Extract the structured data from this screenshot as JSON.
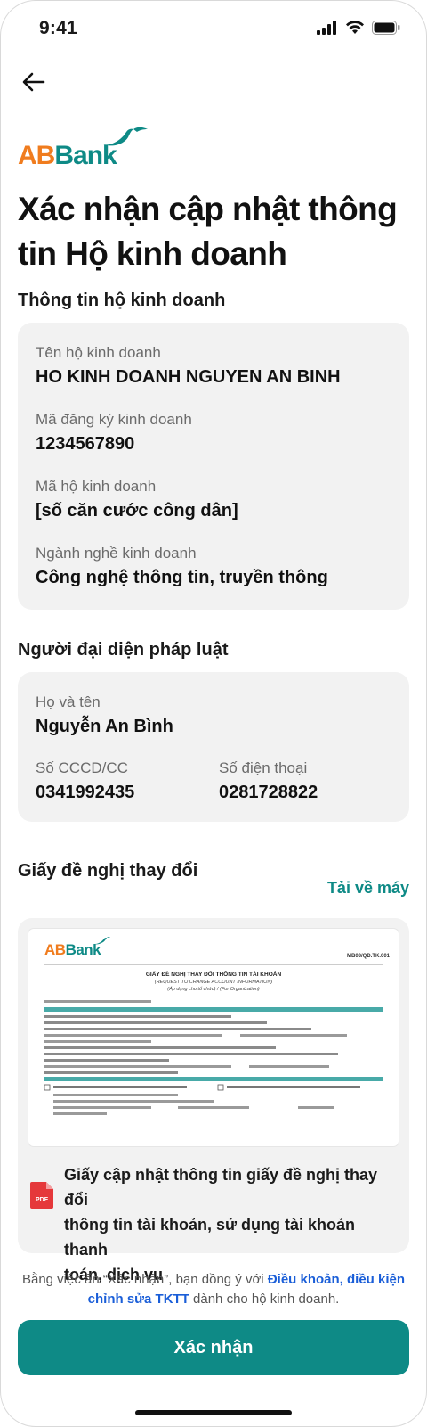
{
  "status_bar": {
    "time": "9:41"
  },
  "header": {
    "back_icon": "arrow-left-icon"
  },
  "logo": {
    "text_ab": "AB",
    "text_bank": "Bank",
    "brand_orange": "#f07c1e",
    "brand_teal": "#0e8a86"
  },
  "title": {
    "line1": "Xác nhận cập nhật thông",
    "line2": "tin Hộ kinh doanh"
  },
  "business": {
    "section_title": "Thông tin hộ kinh doanh",
    "fields": [
      {
        "label": "Tên hộ kinh doanh",
        "value": "HO KINH DOANH NGUYEN AN BINH"
      },
      {
        "label": "Mã đăng ký kinh doanh",
        "value": "1234567890"
      },
      {
        "label": "Mã hộ kinh doanh",
        "value": "[số căn cước công dân]"
      },
      {
        "label": "Ngành nghề kinh doanh",
        "value": "Công nghệ thông tin, truyền thông"
      }
    ]
  },
  "representative": {
    "section_title": "Người đại diện pháp luật",
    "name_label": "Họ và tên",
    "name_value": "Nguyễn An Bình",
    "id_label": "Số CCCD/CC",
    "id_value": "0341992435",
    "phone_label": "Số điện thoại",
    "phone_value": "0281728822"
  },
  "document": {
    "section_title": "Giấy đề nghị thay đổi",
    "download_label": "Tải về máy",
    "name_line1": "Giấy cập nhật thông tin giấy đề nghị thay đổi",
    "name_line2": "thông tin tài khoản, sử dụng tài khoản thanh",
    "name_line3": "toán, dịch vụ",
    "file_icon": "pdf-icon",
    "preview": {
      "logo_ab": "AB",
      "logo_bank": "Bank",
      "code": "MB03/QĐ.TK.001",
      "heading": "GIẤY ĐỀ NGHỊ THAY ĐỔI THÔNG TIN TÀI KHOẢN",
      "subheading": "(REQUEST TO CHANGE ACCOUNT INFORMATION)",
      "subheading2": "(Áp dụng cho tổ chức) / (For Organization)"
    }
  },
  "footer": {
    "terms_prefix": "Bằng việc ấn “Xác nhận”, bạn đồng ý với ",
    "terms_link": "Điều khoản, điều kiện chỉnh sửa TKTT",
    "terms_suffix": " dành cho hộ kinh doanh.",
    "confirm_label": "Xác nhận"
  }
}
